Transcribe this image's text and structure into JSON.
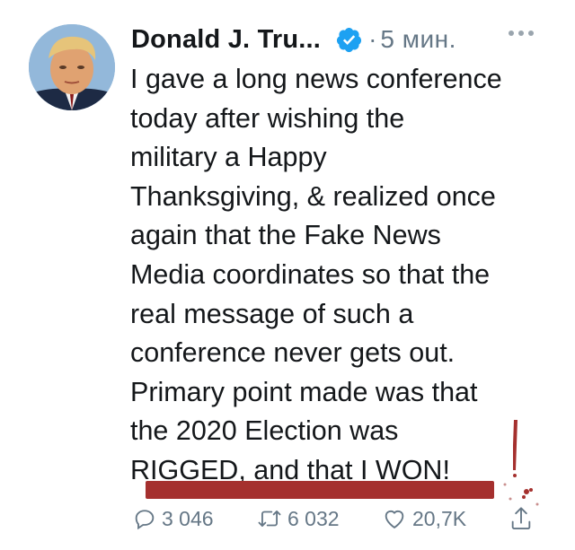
{
  "tweet": {
    "author_name": "Donald J. Tru...",
    "separator": "·",
    "time": "5 мин.",
    "text_lines": [
      "I gave a long news conference",
      "today after wishing the",
      "military a Happy",
      "Thanksgiving, & realized once",
      "again that the Fake News",
      "Media coordinates so that the",
      "real message of such a",
      "conference never gets out.",
      "Primary point made was that",
      "the 2020 Election was",
      "RIGGED, and that I WON!"
    ]
  },
  "actions": {
    "reply_count": "3 046",
    "retweet_count": "6 032",
    "like_count": "20,7K"
  },
  "colors": {
    "verified": "#1da1f2",
    "muted": "#657786",
    "red_mark": "#a5302e"
  },
  "icons": [
    "more-options-icon",
    "verified-badge-icon",
    "reply-icon",
    "retweet-icon",
    "like-icon",
    "share-icon"
  ]
}
